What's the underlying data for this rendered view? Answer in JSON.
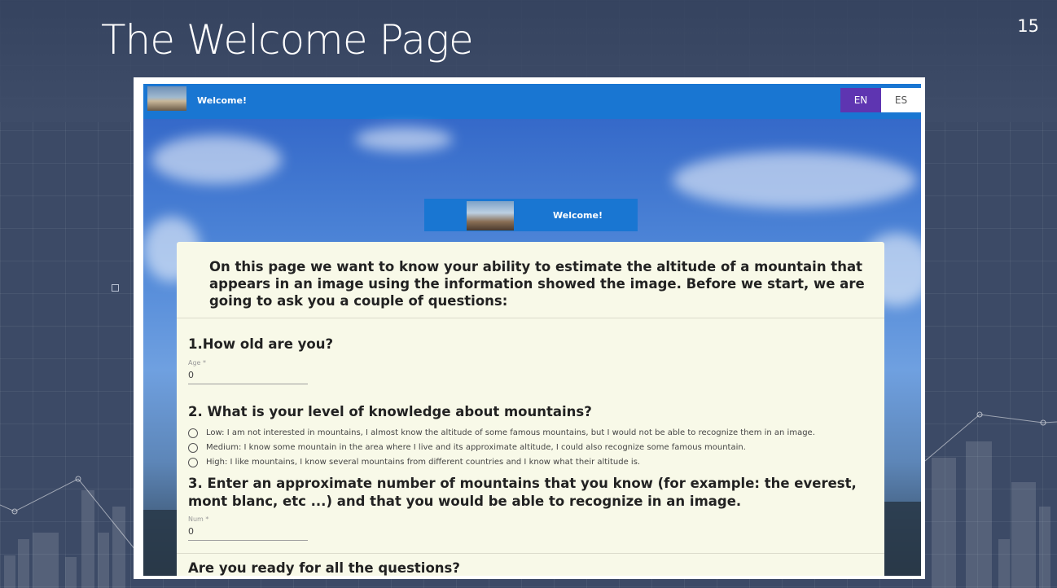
{
  "slide": {
    "title": "The Welcome Page",
    "page_number": "15"
  },
  "app": {
    "appbar_title": "Welcome!",
    "languages": [
      "EN",
      "ES"
    ],
    "selected_language": "EN",
    "banner_title": "Welcome!",
    "intro_text": "On this page we want to know your ability to estimate the altitude of a mountain that appears in an image using the information showed the image. Before we start, we are going to ask you a couple of questions:",
    "q1": {
      "title": "1.How old are you?",
      "field_label": "Age *",
      "field_value": "0"
    },
    "q2": {
      "title": "2. What is your level of knowledge about mountains?",
      "options": [
        "Low: I am not interested in mountains, I almost know the altitude of some famous mountains, but I would not be able to recognize them in an image.",
        "Medium: I know some mountain in the area where I live and its approximate altitude, I could also recognize some famous mountain.",
        "High: I like mountains, I know several mountains from different countries and I know what their altitude is."
      ]
    },
    "q3": {
      "title": "3. Enter an approximate number of mountains that you know (for example: the everest, mont blanc, etc ...) and that you would be able to recognize in an image.",
      "field_label": "Num *",
      "field_value": "0"
    },
    "ready_title": "Are you ready for all the questions?"
  },
  "colors": {
    "appbar": "#1976d2",
    "selected_lang": "#5e35b1",
    "card": "#f8f9e8",
    "slide_bg": "#3c4a66"
  }
}
